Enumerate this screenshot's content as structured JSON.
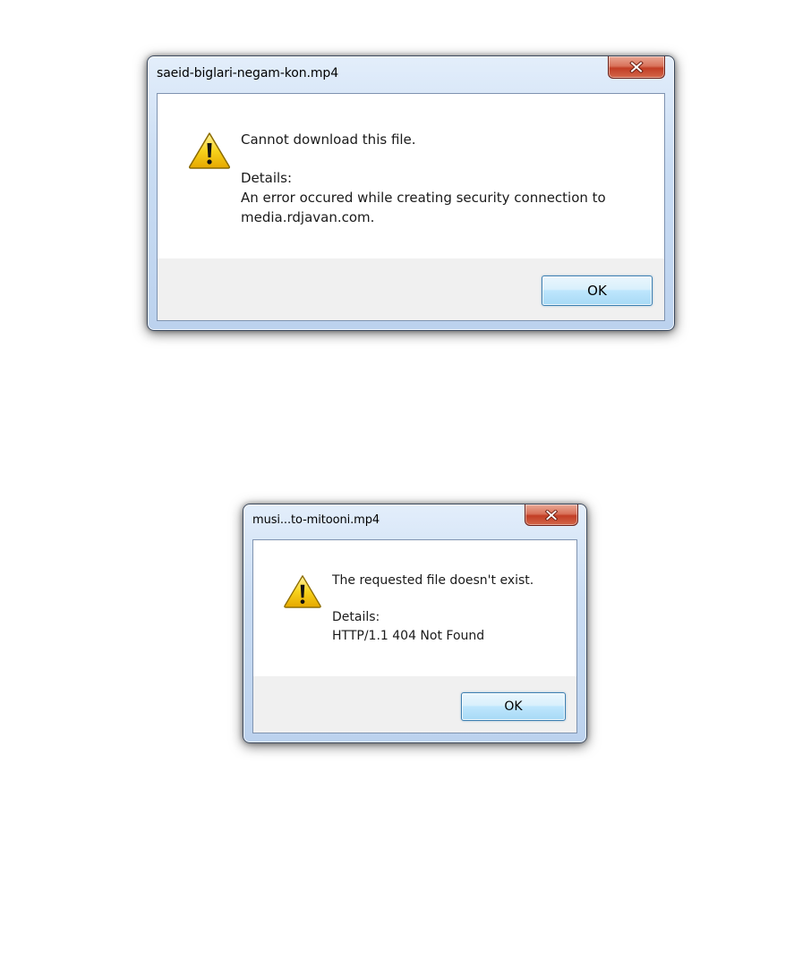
{
  "dialogs": [
    {
      "title": "saeid-biglari-negam-kon.mp4",
      "icon": "warning-icon",
      "message": "Cannot download this file.",
      "details_label": "Details:",
      "details_lines": [
        "An error occured while creating security connection to",
        "media.rdjavan.com."
      ],
      "ok_label": "OK",
      "close_icon": "close-icon"
    },
    {
      "title": "musi...to-mitooni.mp4",
      "icon": "warning-icon",
      "message": "The requested file doesn't exist.",
      "details_label": "Details:",
      "details_lines": [
        "HTTP/1.1 404 Not Found"
      ],
      "ok_label": "OK",
      "close_icon": "close-icon"
    }
  ],
  "colors": {
    "frame": "#c9dcf3",
    "close_button": "#c23e25",
    "ok_button": "#bee6fd",
    "footer": "#f0f0f0",
    "warning_yellow": "#f5c400"
  }
}
